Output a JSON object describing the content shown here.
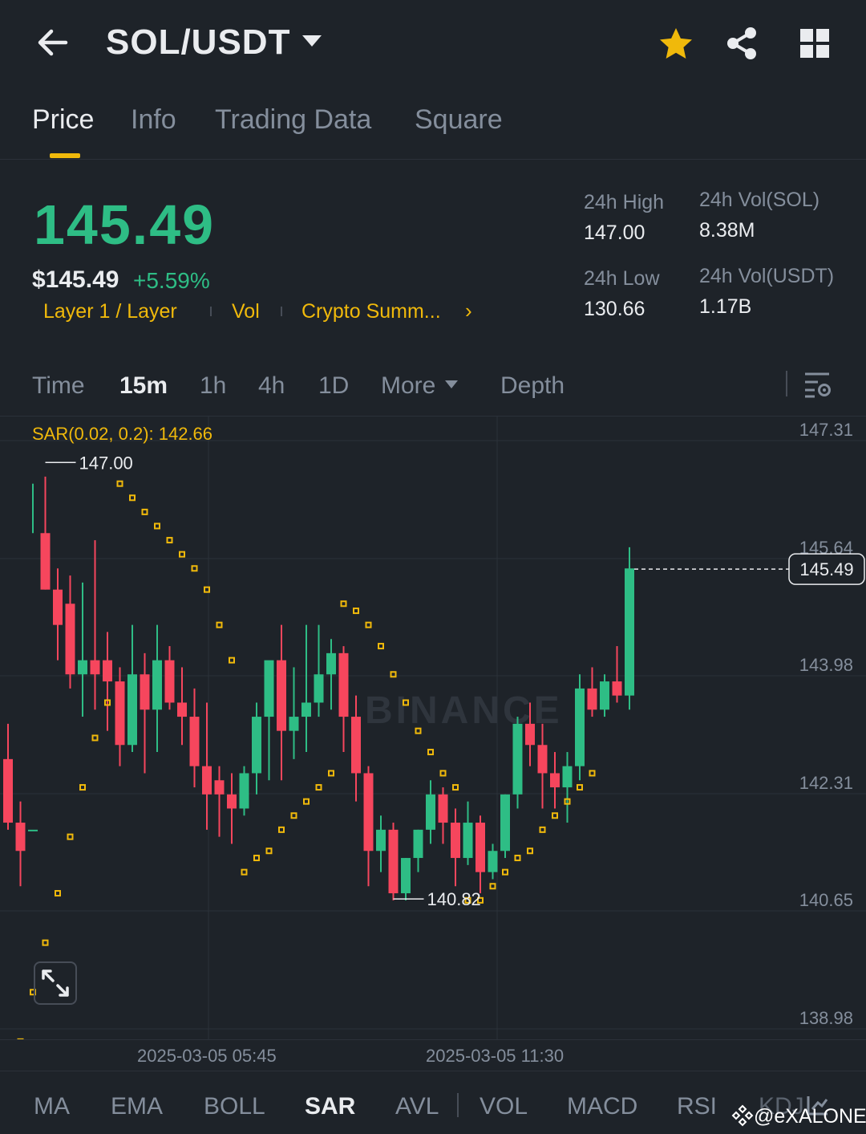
{
  "header": {
    "pair": "SOL/USDT"
  },
  "tabs": [
    "Price",
    "Info",
    "Trading Data",
    "Square"
  ],
  "ticker": {
    "last_price": "145.49",
    "usd_price": "$145.49",
    "change_pct": "+5.59%",
    "tags": [
      "Layer 1 / Layer",
      "Vol",
      "Crypto Summ..."
    ],
    "stats": {
      "high_label": "24h High",
      "high": "147.00",
      "low_label": "24h Low",
      "low": "130.66",
      "vol_sol_label": "24h Vol(SOL)",
      "vol_sol": "8.38M",
      "vol_usdt_label": "24h Vol(USDT)",
      "vol_usdt": "1.17B"
    }
  },
  "timeframes": [
    "Time",
    "15m",
    "1h",
    "4h",
    "1D",
    "More",
    "Depth"
  ],
  "active_timeframe": "15m",
  "chart": {
    "indicator_label": "SAR(0.02, 0.2): 142.66",
    "watermark": "BINANCE",
    "y_ticks": [
      "147.31",
      "145.64",
      "143.98",
      "142.31",
      "140.65",
      "138.98"
    ],
    "x_ticks": [
      "2025-03-05 05:45",
      "2025-03-05 11:30"
    ],
    "high_label": "147.00",
    "low_label": "140.82",
    "last_price_tag": "145.49",
    "colors": {
      "up": "#2ebd85",
      "down": "#f6465d",
      "sar": "#f0b90b"
    }
  },
  "chart_data": {
    "type": "candlestick",
    "symbol": "SOL/USDT",
    "interval": "15m",
    "ylim": [
      138.98,
      147.31
    ],
    "y_ticks": [
      147.31,
      145.64,
      143.98,
      142.31,
      140.65,
      138.98
    ],
    "x_ticks": [
      "2025-03-05 05:45",
      "2025-03-05 11:30"
    ],
    "candles": [
      [
        142.8,
        143.3,
        141.9,
        141.8
      ],
      [
        141.9,
        142.2,
        141.5,
        141.0
      ],
      [
        141.8,
        146.7,
        141.8,
        146.0
      ],
      [
        146.0,
        146.8,
        145.2,
        145.2
      ],
      [
        145.2,
        145.5,
        144.7,
        144.2
      ],
      [
        145.0,
        145.4,
        144.0,
        143.8
      ],
      [
        144.0,
        145.3,
        144.2,
        143.4
      ],
      [
        144.2,
        145.9,
        144.0,
        143.5
      ],
      [
        144.2,
        144.6,
        143.9,
        143.2
      ],
      [
        143.9,
        144.1,
        143.0,
        142.7
      ],
      [
        143.0,
        144.7,
        144.0,
        142.9
      ],
      [
        144.0,
        144.3,
        143.5,
        142.6
      ],
      [
        143.5,
        144.7,
        144.2,
        142.9
      ],
      [
        144.2,
        144.4,
        143.6,
        143.5
      ],
      [
        143.6,
        144.1,
        143.4,
        143.0
      ],
      [
        143.4,
        143.8,
        142.7,
        142.4
      ],
      [
        142.7,
        143.6,
        142.3,
        141.8
      ],
      [
        142.5,
        142.7,
        142.3,
        141.7
      ],
      [
        142.3,
        142.6,
        142.1,
        141.6
      ],
      [
        142.1,
        142.7,
        142.6,
        142.0
      ],
      [
        142.6,
        143.6,
        143.4,
        142.3
      ],
      [
        143.4,
        143.8,
        144.2,
        142.5
      ],
      [
        144.2,
        144.7,
        143.2,
        142.5
      ],
      [
        143.2,
        144.1,
        143.4,
        142.8
      ],
      [
        143.4,
        144.7,
        143.6,
        142.9
      ],
      [
        143.6,
        144.7,
        144.0,
        143.4
      ],
      [
        144.0,
        144.5,
        144.3,
        143.5
      ],
      [
        144.3,
        144.4,
        143.4,
        142.9
      ],
      [
        143.4,
        143.7,
        142.6,
        142.2
      ],
      [
        142.6,
        142.7,
        141.5,
        141.0
      ],
      [
        141.5,
        142.0,
        141.8,
        141.2
      ],
      [
        141.8,
        141.9,
        140.9,
        140.8
      ],
      [
        140.9,
        141.4,
        141.4,
        140.8
      ],
      [
        141.4,
        141.8,
        141.8,
        141.2
      ],
      [
        141.8,
        142.5,
        142.3,
        141.6
      ],
      [
        142.3,
        142.4,
        141.9,
        141.6
      ],
      [
        141.9,
        142.1,
        141.4,
        141.0
      ],
      [
        141.4,
        142.2,
        141.9,
        141.3
      ],
      [
        141.9,
        142.0,
        141.2,
        140.9
      ],
      [
        141.2,
        141.6,
        141.5,
        141.1
      ],
      [
        141.5,
        142.3,
        142.3,
        141.4
      ],
      [
        142.3,
        143.4,
        143.3,
        142.1
      ],
      [
        143.3,
        143.6,
        143.0,
        142.7
      ],
      [
        143.0,
        143.3,
        142.6,
        142.1
      ],
      [
        142.6,
        142.9,
        142.4,
        142.1
      ],
      [
        142.4,
        142.9,
        142.7,
        141.9
      ],
      [
        142.7,
        144.0,
        143.8,
        142.5
      ],
      [
        143.8,
        144.1,
        143.5,
        143.4
      ],
      [
        143.5,
        144.0,
        143.9,
        143.4
      ],
      [
        143.9,
        144.4,
        143.7,
        143.6
      ],
      [
        143.7,
        145.8,
        145.5,
        143.5
      ]
    ],
    "sar": [
      138.5,
      138.8,
      139.5,
      140.2,
      140.9,
      141.7,
      142.4,
      143.1,
      143.6,
      146.7,
      146.5,
      146.3,
      146.1,
      145.9,
      145.7,
      145.5,
      145.2,
      144.7,
      144.2,
      141.2,
      141.4,
      141.5,
      141.8,
      142.0,
      142.2,
      142.4,
      142.6,
      145.0,
      144.9,
      144.7,
      144.4,
      144.0,
      143.6,
      143.2,
      142.9,
      142.6,
      142.4,
      140.8,
      140.8,
      141.0,
      141.2,
      141.4,
      141.5,
      141.8,
      142.0,
      142.2,
      142.4,
      142.6
    ]
  },
  "indicators": [
    "MA",
    "EMA",
    "BOLL",
    "SAR",
    "AVL",
    "VOL",
    "MACD",
    "RSI",
    "KDJ"
  ],
  "active_indicator": "SAR",
  "watermark_user": "@eXALONE"
}
